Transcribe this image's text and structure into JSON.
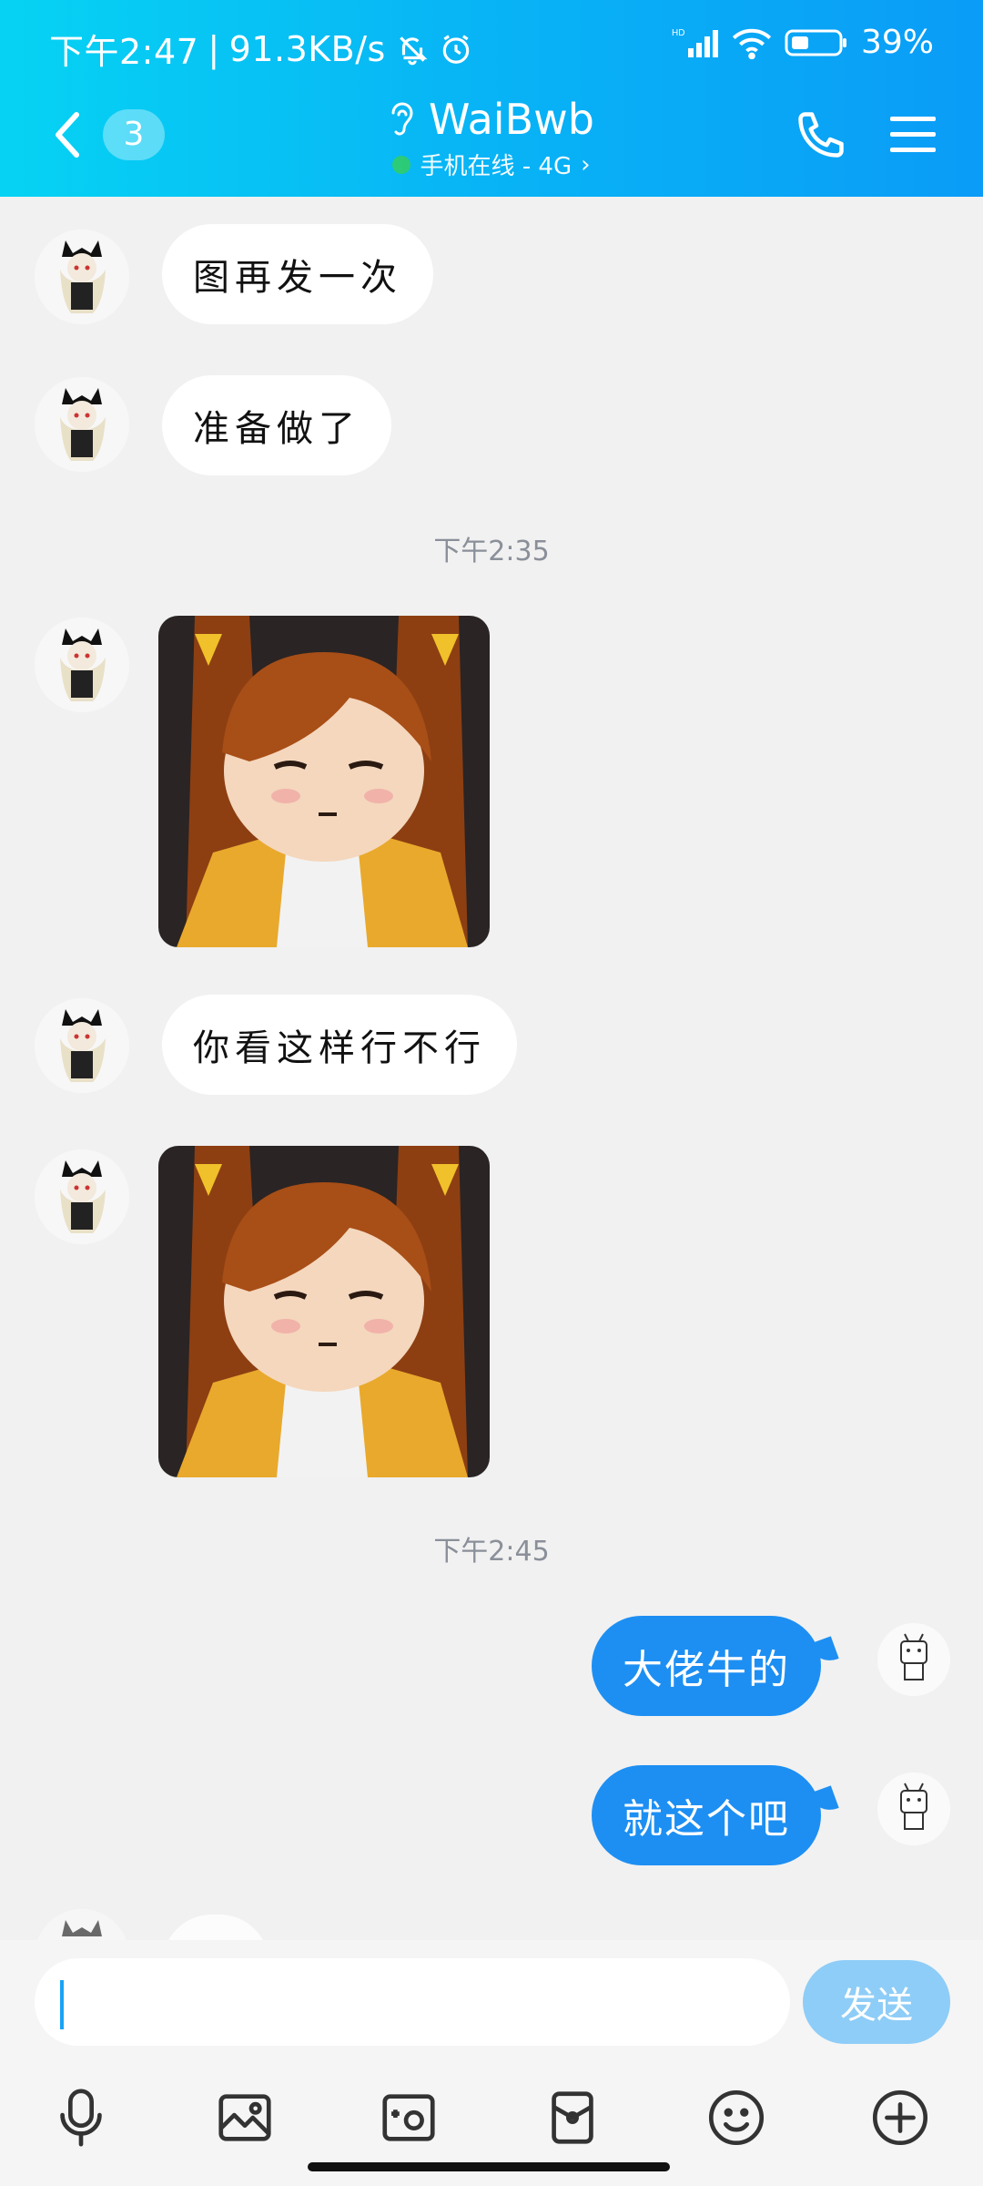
{
  "status_bar": {
    "time": "下午2:47",
    "speed": "91.3KB/s",
    "battery": "39%"
  },
  "header": {
    "unread_count": "3",
    "title": "WaiBwb",
    "subtitle": "手机在线 - 4G"
  },
  "messages": [
    {
      "side": "left",
      "type": "text",
      "text": "图再发一次"
    },
    {
      "side": "left",
      "type": "text",
      "text": "准备做了"
    },
    {
      "type": "time",
      "text": "下午2:35"
    },
    {
      "side": "left",
      "type": "image"
    },
    {
      "side": "left",
      "type": "text",
      "text": "你看这样行不行"
    },
    {
      "side": "left",
      "type": "image"
    },
    {
      "type": "time",
      "text": "下午2:45"
    },
    {
      "side": "right",
      "type": "text",
      "text": "大佬牛的"
    },
    {
      "side": "right",
      "type": "text",
      "text": "就这个吧"
    }
  ],
  "input": {
    "placeholder": "",
    "send_label": "发送"
  },
  "colors": {
    "header_start": "#06d3f3",
    "header_end": "#0a9cf7",
    "my_bubble": "#1d8ff3",
    "send_button": "#8ecdf7"
  },
  "toolbar_icons": [
    "microphone-icon",
    "image-icon",
    "camera-icon",
    "red-packet-icon",
    "emoji-icon",
    "plus-icon"
  ]
}
